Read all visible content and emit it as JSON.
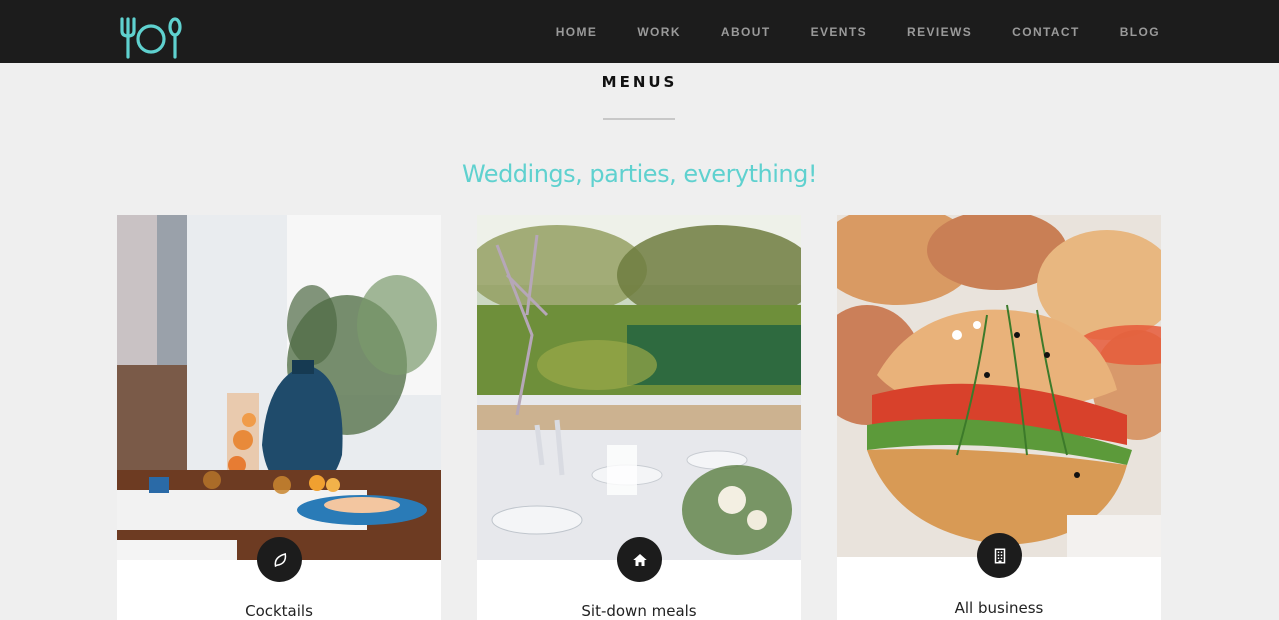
{
  "header": {
    "logo_icon": "fork-plate-spoon-icon",
    "accent_color": "#5fd1cf",
    "nav": [
      {
        "label": "HOME"
      },
      {
        "label": "WORK"
      },
      {
        "label": "ABOUT"
      },
      {
        "label": "EVENTS"
      },
      {
        "label": "REVIEWS"
      },
      {
        "label": "CONTACT"
      },
      {
        "label": "BLOG"
      }
    ]
  },
  "section": {
    "title": "MENUS",
    "tagline": "Weddings, parties, everything!"
  },
  "cards": [
    {
      "label": "Cocktails",
      "icon": "leaf-icon",
      "image": "cocktails-table-photo"
    },
    {
      "label": "Sit-down meals",
      "icon": "home-icon",
      "image": "outdoor-dinner-table-photo"
    },
    {
      "label": "All business",
      "icon": "building-icon",
      "image": "sandwich-platter-photo"
    }
  ]
}
